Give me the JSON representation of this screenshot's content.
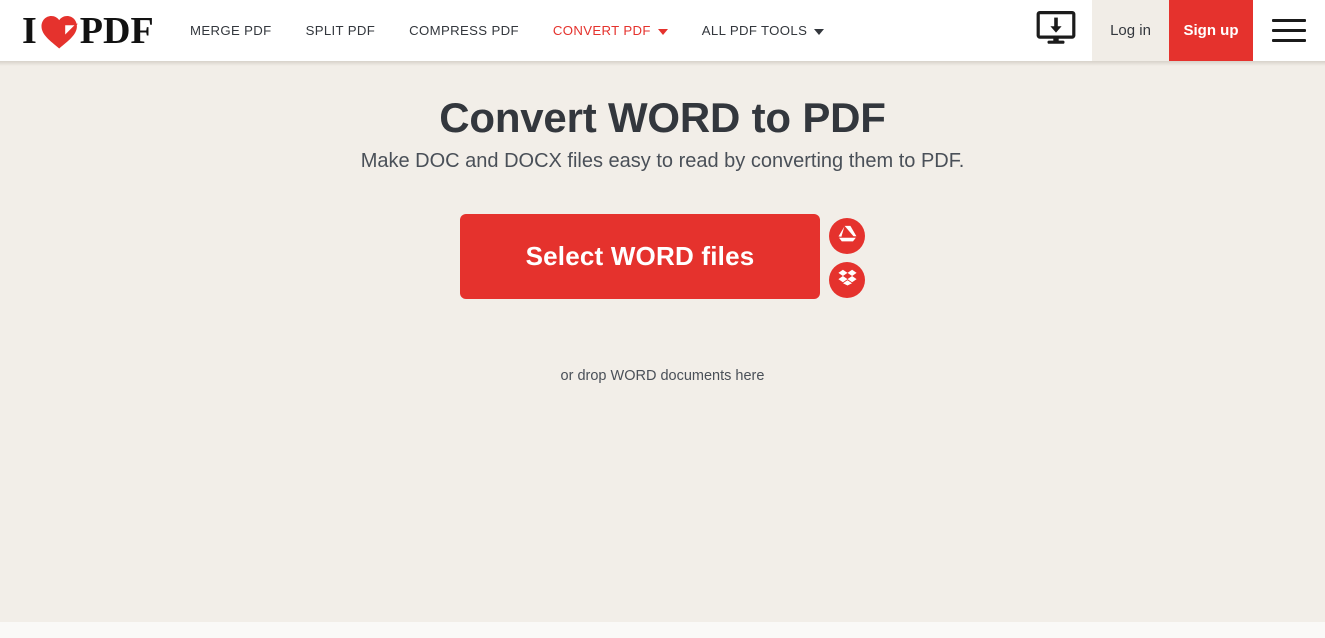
{
  "brand": {
    "logo_i": "I",
    "logo_heart_icon": "heart-fold-icon",
    "logo_pdf": "PDF",
    "accent_color": "#e5322d",
    "text_color": "#33373d",
    "page_background": "#f2eee8",
    "header_background": "#ffffff"
  },
  "header": {
    "nav": [
      {
        "label": "MERGE PDF",
        "active": false,
        "has_caret": false
      },
      {
        "label": "SPLIT PDF",
        "active": false,
        "has_caret": false
      },
      {
        "label": "COMPRESS PDF",
        "active": false,
        "has_caret": false
      },
      {
        "label": "CONVERT PDF",
        "active": true,
        "has_caret": true
      },
      {
        "label": "ALL PDF TOOLS",
        "active": false,
        "has_caret": true
      }
    ],
    "desktop_icon": "desktop-download-icon",
    "login_label": "Log in",
    "signup_label": "Sign up",
    "menu_icon": "hamburger-menu-icon"
  },
  "main": {
    "title": "Convert WORD to PDF",
    "subtitle": "Make DOC and DOCX files easy to read by converting them to PDF.",
    "select_button_label": "Select WORD files",
    "cloud_buttons": [
      {
        "name": "google-drive-button",
        "icon": "google-drive-icon"
      },
      {
        "name": "dropbox-button",
        "icon": "dropbox-icon"
      }
    ],
    "drop_hint": "or drop WORD documents here"
  }
}
